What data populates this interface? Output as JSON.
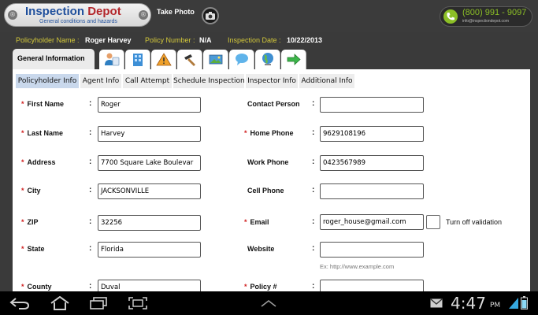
{
  "header": {
    "logo_title_a": "Inspection",
    "logo_title_b": "Depot",
    "logo_subtitle": "General conditions and hazards",
    "take_photo_label": "Take Photo",
    "phone_number": "(800) 991 - 9097",
    "email": "info@inspectiondepot.com"
  },
  "policy_bar": {
    "policyholder_label": "Policyholder Name :",
    "policyholder_value": "Roger Harvey",
    "policy_number_label": "Policy Number :",
    "policy_number_value": "N/A",
    "inspection_date_label": "Inspection Date :",
    "inspection_date_value": "10/22/2013"
  },
  "main_tabs": {
    "general_label": "General Information",
    "icon_tabs": [
      "person-icon",
      "building-icon",
      "hazard-icon",
      "hammer-icon",
      "photo-icon",
      "chat-icon",
      "globe-icon",
      "arrow-right-icon"
    ]
  },
  "sub_tabs": [
    "Policyholder Info",
    "Agent Info",
    "Call Attempt",
    "Schedule Inspection",
    "Inspector Info",
    "Additional Info"
  ],
  "form": {
    "left": [
      {
        "label": "First Name",
        "required": "*",
        "value": "Roger"
      },
      {
        "label": "Last Name",
        "required": "*",
        "value": "Harvey"
      },
      {
        "label": "Address",
        "required": "*",
        "value": "7700 Square Lake Boulevar"
      },
      {
        "label": "City",
        "required": "*",
        "value": "JACKSONVILLE"
      },
      {
        "label": "ZIP",
        "required": "*",
        "value": "32256"
      },
      {
        "label": "State",
        "required": "*",
        "value": "Florida"
      },
      {
        "label": "County",
        "required": "*",
        "value": "Duval"
      }
    ],
    "right": [
      {
        "label": "Contact Person",
        "required": "",
        "value": ""
      },
      {
        "label": "Home Phone",
        "required": "*",
        "value": "9629108196"
      },
      {
        "label": "Work Phone",
        "required": "",
        "value": "0423567989"
      },
      {
        "label": "Cell Phone",
        "required": "",
        "value": ""
      },
      {
        "label": "Email",
        "required": "*",
        "value": "roger_house@gmail.com"
      },
      {
        "label": "Website",
        "required": "",
        "value": ""
      },
      {
        "label": "Policy #",
        "required": "*",
        "value": ""
      }
    ],
    "colon": ":",
    "website_hint": "Ex:  http://www.example.com",
    "validation_label": "Turn off validation"
  },
  "system_bar": {
    "time": "4:47",
    "ampm": "PM"
  },
  "colors": {
    "accent_green": "#8cbf26",
    "label_yellow": "#d3c83a",
    "required_red": "#d02020",
    "active_subtab": "#c9d8ec"
  }
}
